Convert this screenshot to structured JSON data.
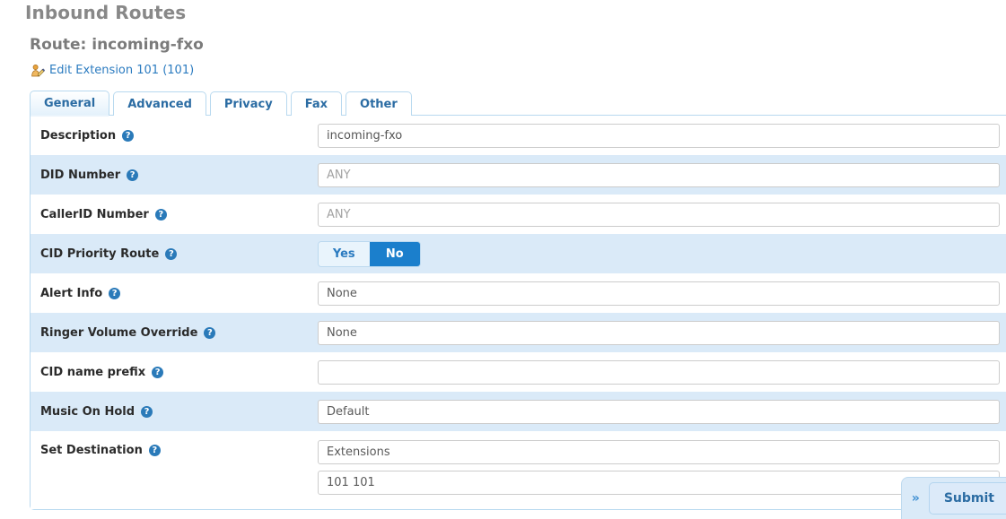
{
  "page": {
    "title": "Inbound Routes",
    "route_title": "Route: incoming-fxo",
    "edit_link": "Edit Extension 101 (101)",
    "edit_icon": "user-edit-icon"
  },
  "tabs": [
    {
      "label": "General",
      "active": true
    },
    {
      "label": "Advanced",
      "active": false
    },
    {
      "label": "Privacy",
      "active": false
    },
    {
      "label": "Fax",
      "active": false
    },
    {
      "label": "Other",
      "active": false
    }
  ],
  "help_glyph": "?",
  "form": {
    "description": {
      "label": "Description",
      "value": "incoming-fxo",
      "placeholder": ""
    },
    "did_number": {
      "label": "DID Number",
      "value": "",
      "placeholder": "ANY"
    },
    "callerid_number": {
      "label": "CallerID Number",
      "value": "",
      "placeholder": "ANY"
    },
    "cid_priority": {
      "label": "CID Priority Route",
      "yes": "Yes",
      "no": "No",
      "selected": "No"
    },
    "alert_info": {
      "label": "Alert Info",
      "value": "None",
      "placeholder": ""
    },
    "ringer_volume": {
      "label": "Ringer Volume Override",
      "value": "None",
      "placeholder": ""
    },
    "cid_name_prefix": {
      "label": "CID name prefix",
      "value": "",
      "placeholder": ""
    },
    "music_on_hold": {
      "label": "Music On Hold",
      "value": "Default",
      "placeholder": ""
    },
    "set_destination": {
      "label": "Set Destination",
      "value": "Extensions",
      "target": "101 101"
    }
  },
  "dock": {
    "chevron": "»",
    "submit_label": "Submit"
  },
  "colors": {
    "accent_blue": "#1b7fcc",
    "link_blue": "#2b7bc0",
    "row_alt": "#daeaf8",
    "panel_border": "#b8d9ef",
    "heading_gray": "#888888"
  }
}
